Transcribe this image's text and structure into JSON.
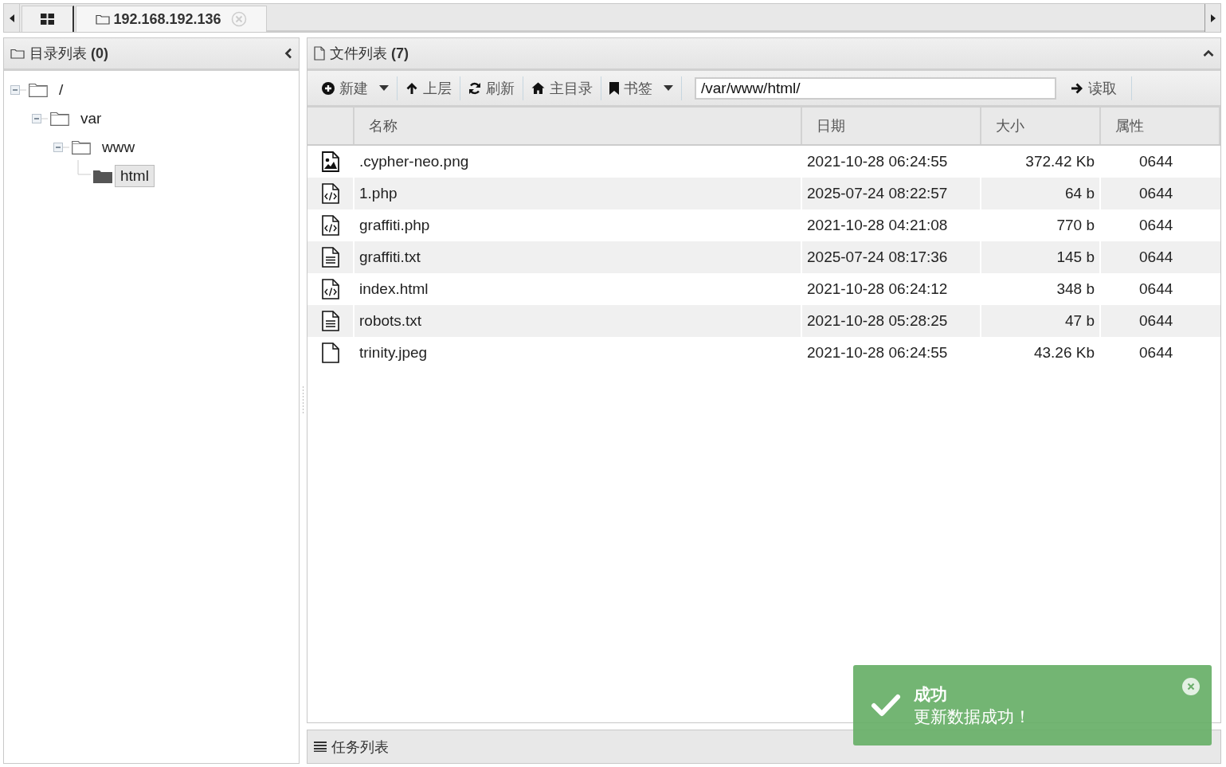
{
  "tabs": [
    {
      "kind": "home",
      "selected": false
    },
    {
      "kind": "folder",
      "label": "192.168.192.136",
      "selected": true
    }
  ],
  "dir_panel": {
    "title": "目录列表 **(0)**"
  },
  "tree": [
    {
      "label": "/",
      "expanded": true,
      "selected": false,
      "children": [
        {
          "label": "var",
          "expanded": true,
          "selected": false,
          "children": [
            {
              "label": "www",
              "expanded": true,
              "selected": false,
              "children": [
                {
                  "label": "html",
                  "selected": true
                }
              ]
            }
          ]
        }
      ]
    }
  ],
  "file_panel": {
    "title": "文件列表 **(7)**"
  },
  "toolbar": [
    {
      "kind": "new",
      "label": "新建",
      "dropdown": true
    },
    {
      "kind": "up",
      "label": "上层",
      "dropdown": false
    },
    {
      "kind": "refresh",
      "label": "刷新",
      "dropdown": false
    },
    {
      "kind": "home",
      "label": "主目录",
      "dropdown": false
    },
    {
      "kind": "bookmark",
      "label": "书签",
      "dropdown": true
    }
  ],
  "path_field": {
    "value": "/var/www/html/"
  },
  "read_button": {
    "label": "读取"
  },
  "columns": [
    "名称",
    "日期",
    "大小",
    "属性"
  ],
  "rows": [
    {
      "kind": "image",
      "name": ".cypher-neo.png",
      "date": "2021-10-28 06:24:55",
      "size": "372.42 Kb",
      "perm": "0644"
    },
    {
      "kind": "code",
      "name": "1.php",
      "date": "2025-07-24 08:22:57",
      "size": "64 b",
      "perm": "0644"
    },
    {
      "kind": "code",
      "name": "graffiti.php",
      "date": "2021-10-28 04:21:08",
      "size": "770 b",
      "perm": "0644"
    },
    {
      "kind": "text",
      "name": "graffiti.txt",
      "date": "2025-07-24 08:17:36",
      "size": "145 b",
      "perm": "0644"
    },
    {
      "kind": "code",
      "name": "index.html",
      "date": "2021-10-28 06:24:12",
      "size": "348 b",
      "perm": "0644"
    },
    {
      "kind": "text",
      "name": "robots.txt",
      "date": "2021-10-28 05:28:25",
      "size": "47 b",
      "perm": "0644"
    },
    {
      "kind": "blank",
      "name": "trinity.jpeg",
      "date": "2021-10-28 06:24:55",
      "size": "43.26 Kb",
      "perm": "0644"
    }
  ],
  "task_panel": {
    "title": "任务列表"
  },
  "toast": {
    "title": "成功",
    "message": "更新数据成功！"
  }
}
